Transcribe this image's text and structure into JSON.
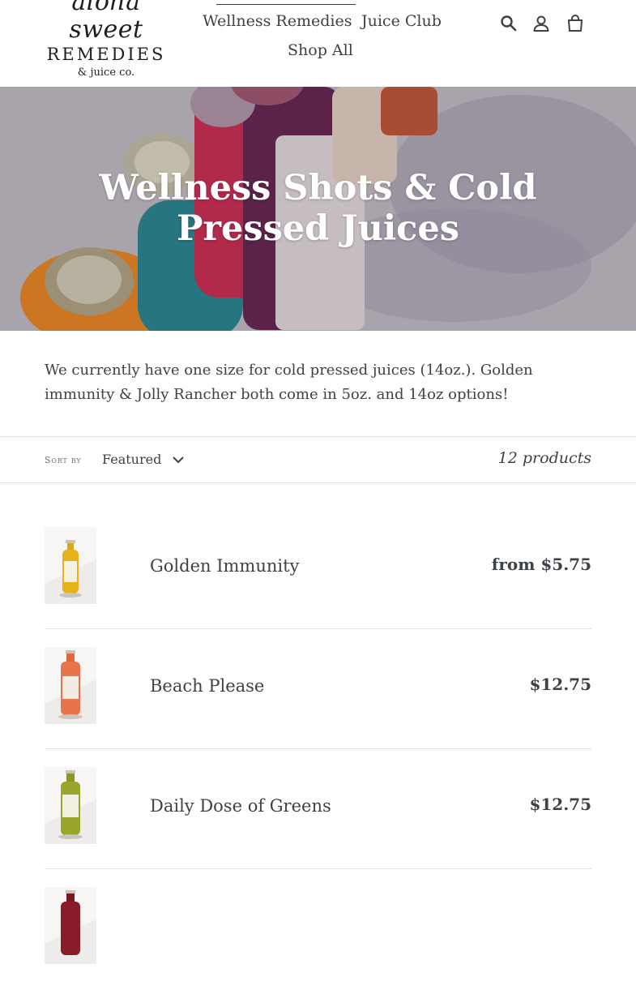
{
  "brand": {
    "script": "aloha sweet",
    "caps": "REMEDIES",
    "small": "& juice co."
  },
  "nav": {
    "items": [
      "Wellness Remedies",
      "Juice Club",
      "Shop All"
    ],
    "icons": [
      "search-icon",
      "account-icon",
      "cart-icon"
    ]
  },
  "hero": {
    "title": "Wellness Shots & Cold Pressed Juices"
  },
  "description": "We currently have one size for cold pressed juices (14oz.). Golden immunity & Jolly Rancher both come in 5oz. and 14oz options!",
  "filters": {
    "sort_label": "Sort by",
    "sort_value": "Featured",
    "count": "12 products"
  },
  "products": [
    {
      "name": "Golden Immunity",
      "price": "from $5.75",
      "color": "#e6b21c"
    },
    {
      "name": "Beach Please",
      "price": "$12.75",
      "color": "#e7744a"
    },
    {
      "name": "Daily Dose of Greens",
      "price": "$12.75",
      "color": "#9aa52b"
    },
    {
      "name": "",
      "price": "",
      "color": "#8a1c2a"
    }
  ],
  "colors": {
    "text": "#3d4246",
    "border": "#e3e3e3",
    "hero_overlay": "#c8c4cc"
  }
}
